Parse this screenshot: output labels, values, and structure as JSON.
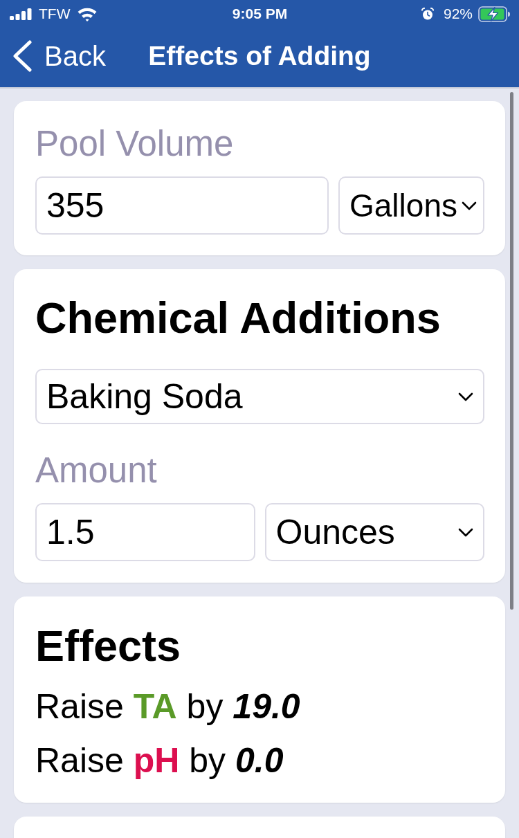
{
  "status_bar": {
    "carrier": "TFW",
    "time": "9:05 PM",
    "battery": "92%"
  },
  "nav": {
    "back": "Back",
    "title": "Effects of Adding"
  },
  "pool_volume": {
    "label": "Pool Volume",
    "value": "355",
    "unit": "Gallons"
  },
  "chemical_additions": {
    "title": "Chemical Additions",
    "chemical": "Baking Soda",
    "amount_label": "Amount",
    "amount": "1.5",
    "amount_unit": "Ounces"
  },
  "effects": {
    "title": "Effects",
    "items": [
      {
        "verb": "Raise",
        "target": "TA",
        "color": "#5a9a28",
        "preposition": "by",
        "amount": "19.0"
      },
      {
        "verb": "Raise",
        "target": "pH",
        "color": "#dc0f4f",
        "preposition": "by",
        "amount": "0.0"
      }
    ]
  }
}
